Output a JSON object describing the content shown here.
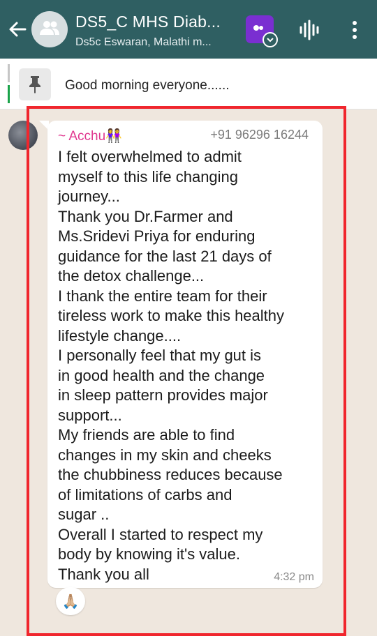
{
  "header": {
    "title": "DS5_C MHS Diab...",
    "subtitle": "Ds5c Eswaran, Malathi m..."
  },
  "pinned": {
    "text": "Good morning everyone......"
  },
  "message": {
    "sender_name": "~ Acchu👭",
    "sender_phone": "+91 96296 16244",
    "lines": [
      "I felt overwhelmed to admit",
      "myself to this life changing",
      "journey...",
      "Thank you Dr.Farmer and",
      "Ms.Sridevi Priya for enduring",
      "guidance for the last 21 days of",
      "the detox challenge...",
      "I thank the entire team for their",
      "tireless work to make this healthy",
      "lifestyle change....",
      "I personally feel that my gut is",
      "in good health and the change",
      "in sleep pattern provides major",
      "support...",
      "My friends are able to find",
      "changes in my skin and cheeks",
      "the chubbiness reduces because",
      "of limitations of carbs and",
      "sugar ..",
      "Overall I started to respect my",
      "body by knowing it's value.",
      "Thank you all"
    ],
    "time": "4:32 pm",
    "reaction": "🙏🏼"
  },
  "colors": {
    "header_bg": "#2f5f62",
    "sender_name": "#e0388f",
    "highlight_border": "#f0262d",
    "chat_bg": "#efe7de"
  },
  "icons": {
    "back": "arrow-left-icon",
    "group_avatar": "group-icon",
    "app": "app-badge-icon",
    "voice": "audio-wave-icon",
    "more": "more-vertical-icon",
    "pin": "pin-icon"
  }
}
